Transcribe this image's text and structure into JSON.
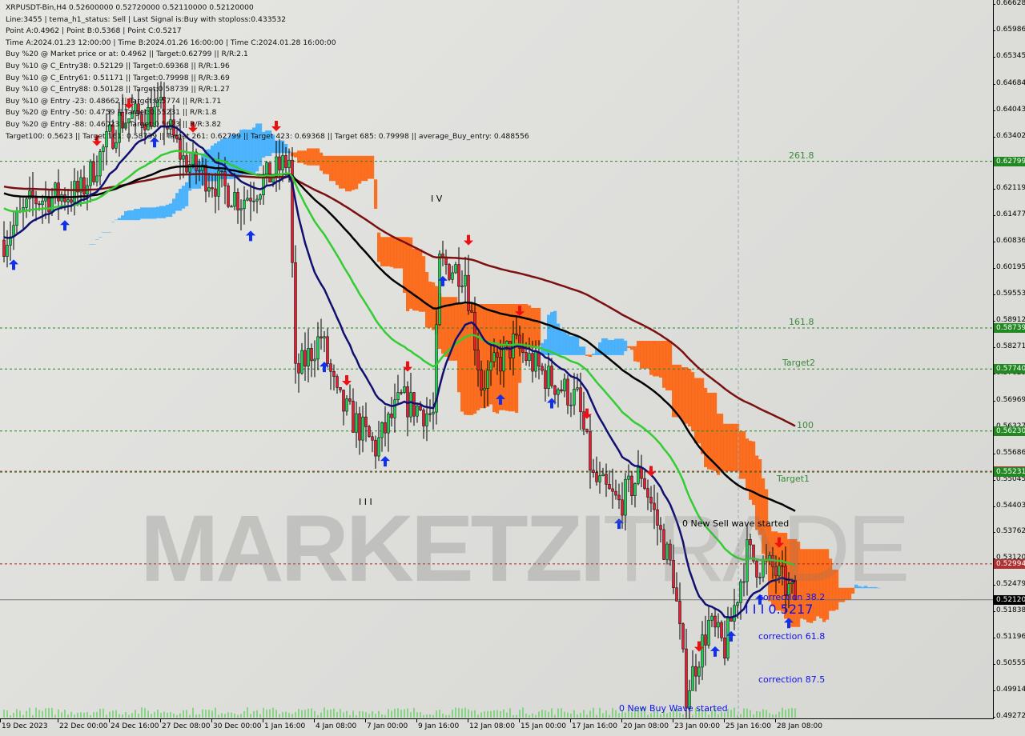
{
  "info_lines": [
    "XRPUSDT-Bin,H4  0.52600000 0.52720000 0.52110000 0.52120000",
    "Line:3455 | tema_h1_status: Sell | Last Signal is:Buy with stoploss:0.433532",
    "Point A:0.4962 | Point B:0.5368 | Point C:0.5217",
    "Time A:2024.01.23 12:00:00 | Time B:2024.01.26 16:00:00 | Time C:2024.01.28 16:00:00",
    "Buy %20 @ Market price or at: 0.4962 || Target:0.62799 || R/R:2.1",
    "Buy %10 @ C_Entry38: 0.52129 || Target:0.69368 || R/R:1.96",
    "Buy %10 @ C_Entry61: 0.51171 || Target:0.79998 || R/R:3.69",
    "Buy %10 @ C_Entry88: 0.50128 || Target:0.58739 || R/R:1.27",
    "Buy %10 @ Entry -23: 0.48662 || Target:0.5774 || R/R:1.71",
    "Buy %20 @ Entry -50: 0.4759 || Target:0.55231 || R/R:1.8",
    "Buy %20 @ Entry -88: 0.46023 || Target:0.5623 || R/R:3.82",
    "Target100: 0.5623 || Target 161: 0.58739 || Target 261: 0.62799 || Target 423: 0.69368 || Target 685: 0.79998 || average_Buy_entry: 0.488556"
  ],
  "watermark": {
    "bold": "MARKETZI",
    "thin": "TRADE"
  },
  "colors": {
    "bull": "#22cc55",
    "bear": "#dd2233",
    "ema_fast": "#101070",
    "ema_mid": "#33cc33",
    "ema_slow": "#000000",
    "ema_slowest": "#7a1010",
    "cloud_bear": "#ff5a00",
    "cloud_bull": "#33aaff",
    "level_green": "#228822",
    "level_red": "#aa2222",
    "current": "#000000"
  },
  "chart_data": {
    "type": "candlestick",
    "symbol": "XRPUSDT-Bin",
    "timeframe": "H4",
    "ylim": [
      0.49272,
      0.66628
    ],
    "y_ticks": [
      "0.66628",
      "0.65986",
      "0.65345",
      "0.64684",
      "0.64043",
      "0.63402",
      "0.62119",
      "0.61477",
      "0.60836",
      "0.60195",
      "0.59553",
      "0.58912",
      "0.58271",
      "0.57629",
      "0.56969",
      "0.56327",
      "0.55686",
      "0.55045",
      "0.54403",
      "0.53762",
      "0.53120",
      "0.52479",
      "0.51838",
      "0.51196",
      "0.50555",
      "0.49914",
      "0.49272"
    ],
    "x_ticks": [
      {
        "label": "19 Dec 2023",
        "t": "2023-12-19T00:00"
      },
      {
        "label": "22 Dec 00:00",
        "t": "2023-12-22T00:00"
      },
      {
        "label": "24 Dec 16:00",
        "t": "2023-12-24T16:00"
      },
      {
        "label": "27 Dec 08:00",
        "t": "2023-12-27T08:00"
      },
      {
        "label": "30 Dec 00:00",
        "t": "2023-12-30T00:00"
      },
      {
        "label": "1 Jan 16:00",
        "t": "2024-01-01T16:00"
      },
      {
        "label": "4 Jan 08:00",
        "t": "2024-01-04T08:00"
      },
      {
        "label": "7 Jan 00:00",
        "t": "2024-01-07T00:00"
      },
      {
        "label": "9 Jan 16:00",
        "t": "2024-01-09T16:00"
      },
      {
        "label": "12 Jan 08:00",
        "t": "2024-01-12T08:00"
      },
      {
        "label": "15 Jan 00:00",
        "t": "2024-01-15T00:00"
      },
      {
        "label": "17 Jan 16:00",
        "t": "2024-01-17T16:00"
      },
      {
        "label": "20 Jan 08:00",
        "t": "2024-01-20T08:00"
      },
      {
        "label": "23 Jan 00:00",
        "t": "2024-01-23T00:00"
      },
      {
        "label": "25 Jan 16:00",
        "t": "2024-01-25T16:00"
      },
      {
        "label": "28 Jan 08:00",
        "t": "2024-01-28T08:00"
      }
    ],
    "close_path": [
      [
        "2023-12-19T00:00",
        0.6088
      ],
      [
        "2023-12-20T12:00",
        0.6185
      ],
      [
        "2023-12-23T00:00",
        0.6205
      ],
      [
        "2023-12-25T00:00",
        0.638
      ],
      [
        "2023-12-27T04:00",
        0.64
      ],
      [
        "2023-12-28T08:00",
        0.6283
      ],
      [
        "2023-12-31T08:00",
        0.6185
      ],
      [
        "2024-01-02T20:00",
        0.6283
      ],
      [
        "2024-01-03T04:00",
        0.5757
      ],
      [
        "2024-01-04T12:00",
        0.5854
      ],
      [
        "2024-01-05T08:00",
        0.5699
      ],
      [
        "2024-01-07T08:00",
        0.5582
      ],
      [
        "2024-01-08T16:00",
        0.5699
      ],
      [
        "2024-01-10T08:00",
        0.566
      ],
      [
        "2024-01-10T16:00",
        0.603
      ],
      [
        "2024-01-12T00:00",
        0.601
      ],
      [
        "2024-01-12T20:00",
        0.5737
      ],
      [
        "2024-01-14T12:00",
        0.5835
      ],
      [
        "2024-01-16T04:00",
        0.5757
      ],
      [
        "2024-01-17T20:00",
        0.5699
      ],
      [
        "2024-01-18T16:00",
        0.5504
      ],
      [
        "2024-01-20T00:00",
        0.5445
      ],
      [
        "2024-01-21T04:00",
        0.5523
      ],
      [
        "2024-01-22T20:00",
        0.527
      ],
      [
        "2024-01-23T12:00",
        0.4985
      ],
      [
        "2024-01-24T16:00",
        0.5153
      ],
      [
        "2024-01-25T12:00",
        0.5095
      ],
      [
        "2024-01-26T16:00",
        0.5328
      ],
      [
        "2024-01-27T04:00",
        0.53
      ],
      [
        "2024-01-28T00:00",
        0.5289
      ],
      [
        "2024-01-29T04:00",
        0.5212
      ]
    ],
    "last": {
      "open": 0.526,
      "high": 0.5272,
      "low": 0.5211,
      "close": 0.5212
    },
    "levels": [
      {
        "price": 0.62799,
        "tag": "0.62799",
        "label": "261.8",
        "color": "green"
      },
      {
        "price": 0.58739,
        "tag": "0.58739",
        "label": "161.8",
        "color": "green"
      },
      {
        "price": 0.5774,
        "tag": "0.57740",
        "label": "Target2",
        "color": "green"
      },
      {
        "price": 0.5623,
        "tag": "0.56230",
        "label": "100",
        "color": "green"
      },
      {
        "price": 0.5525,
        "tag": "0.55250",
        "label": "",
        "color": "red"
      },
      {
        "price": 0.55231,
        "tag": "0.55231",
        "label": "Target1",
        "color": "green"
      },
      {
        "price": 0.52994,
        "tag": "0.52994",
        "label": "",
        "color": "red"
      },
      {
        "price": 0.5212,
        "tag": "0.52120",
        "label": "",
        "color": "current"
      }
    ],
    "annotations": [
      {
        "text": "0 New Sell wave started",
        "t": "2024-01-23T07:00",
        "price": 0.5395,
        "color": "#000000"
      },
      {
        "text": "correction 38.2",
        "t": "2024-01-27T06:00",
        "price": 0.5215,
        "color": "#1010ee"
      },
      {
        "text": "I I I 0.5217",
        "t": "2024-01-26T13:00",
        "price": 0.5192,
        "color": "#1010ee",
        "big": true
      },
      {
        "text": "correction 61.8",
        "t": "2024-01-27T06:00",
        "price": 0.512,
        "color": "#1010ee"
      },
      {
        "text": "correction 87.5",
        "t": "2024-01-27T06:00",
        "price": 0.5015,
        "color": "#1010ee"
      },
      {
        "text": "0 New Buy Wave started",
        "t": "2024-01-20T00:00",
        "price": 0.4945,
        "color": "#1010ee"
      },
      {
        "text": "I V",
        "t": "2024-01-10T05:00",
        "price": 0.6185,
        "color": "#000000"
      },
      {
        "text": "I I I",
        "t": "2024-01-06T11:00",
        "price": 0.5447,
        "color": "#000000"
      }
    ],
    "signals": [
      {
        "t": "2023-12-19T12:00",
        "dir": "up"
      },
      {
        "t": "2023-12-22T04:00",
        "dir": "up"
      },
      {
        "t": "2023-12-23T20:00",
        "dir": "down"
      },
      {
        "t": "2023-12-25T12:00",
        "dir": "down"
      },
      {
        "t": "2023-12-26T20:00",
        "dir": "up"
      },
      {
        "t": "2023-12-28T20:00",
        "dir": "down"
      },
      {
        "t": "2023-12-31T20:00",
        "dir": "up"
      },
      {
        "t": "2024-01-02T04:00",
        "dir": "down"
      },
      {
        "t": "2024-01-04T16:00",
        "dir": "up"
      },
      {
        "t": "2024-01-05T20:00",
        "dir": "down"
      },
      {
        "t": "2024-01-07T20:00",
        "dir": "up"
      },
      {
        "t": "2024-01-09T00:00",
        "dir": "down"
      },
      {
        "t": "2024-01-10T20:00",
        "dir": "up"
      },
      {
        "t": "2024-01-12T04:00",
        "dir": "down"
      },
      {
        "t": "2024-01-13T20:00",
        "dir": "up"
      },
      {
        "t": "2024-01-14T20:00",
        "dir": "down"
      },
      {
        "t": "2024-01-16T12:00",
        "dir": "up"
      },
      {
        "t": "2024-01-18T08:00",
        "dir": "down"
      },
      {
        "t": "2024-01-20T00:00",
        "dir": "up"
      },
      {
        "t": "2024-01-21T16:00",
        "dir": "down"
      },
      {
        "t": "2024-01-24T04:00",
        "dir": "down"
      },
      {
        "t": "2024-01-25T00:00",
        "dir": "up"
      },
      {
        "t": "2024-01-25T20:00",
        "dir": "up"
      },
      {
        "t": "2024-01-27T08:00",
        "dir": "up"
      },
      {
        "t": "2024-01-28T08:00",
        "dir": "down"
      },
      {
        "t": "2024-01-28T20:00",
        "dir": "up"
      }
    ]
  }
}
